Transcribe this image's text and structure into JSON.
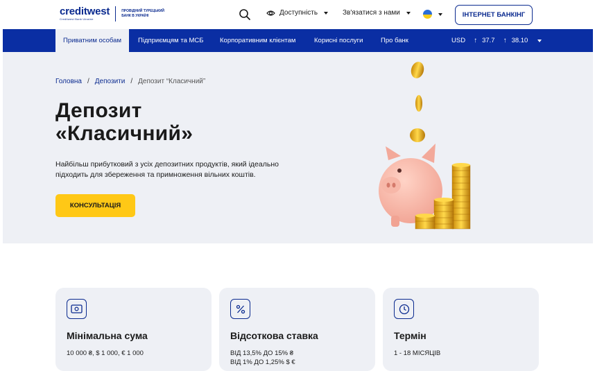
{
  "header": {
    "logo_word": "creditwest",
    "logo_sub": "Creditwest Bank Ukraine",
    "logo_tag": "ПРОВІДНИЙ ТУРЕЦЬКИЙ БАНК В УКРАЇНІ",
    "accessibility_label": "Доступність",
    "contact_label": "Зв'язатися з нами",
    "internet_banking_label": "ІНТЕРНЕТ БАНКІНГ"
  },
  "nav": {
    "items": [
      {
        "label": "Приватним особам",
        "active": true
      },
      {
        "label": "Підприємцям та МСБ"
      },
      {
        "label": "Корпоративним клієнтам"
      },
      {
        "label": "Корисні послуги"
      },
      {
        "label": "Про банк"
      }
    ],
    "currency": "USD",
    "buy_rate": "37.7",
    "sell_rate": "38.10"
  },
  "hero": {
    "breadcrumb": [
      "Головна",
      "Депозити",
      "Депозит “Класичний”"
    ],
    "title_line1": "Депозит",
    "title_line2": "«Класичний»",
    "description": "Найбільш прибутковий з усіх депозитних продуктів, який ідеально підходить для збереження та примноження вільних коштів.",
    "cta_label": "КОНСУЛЬТАЦІЯ"
  },
  "cards": [
    {
      "icon": "money-icon",
      "title": "Мінімальна сума",
      "value": "10 000 ₴, $ 1 000, € 1 000",
      "value2": ""
    },
    {
      "icon": "percent-icon",
      "title": "Відсоткова ставка",
      "value": "ВІД 13,5% ДО 15% ₴",
      "value2": "ВІД 1% ДО 1,25% $ €"
    },
    {
      "icon": "clock-icon",
      "title": "Термін",
      "value": "1 - 18 МІСЯЦІВ",
      "value2": ""
    }
  ],
  "colors": {
    "brand_blue": "#0a2ea3",
    "accent_yellow": "#ffc816",
    "hero_bg": "#eef0f5"
  }
}
